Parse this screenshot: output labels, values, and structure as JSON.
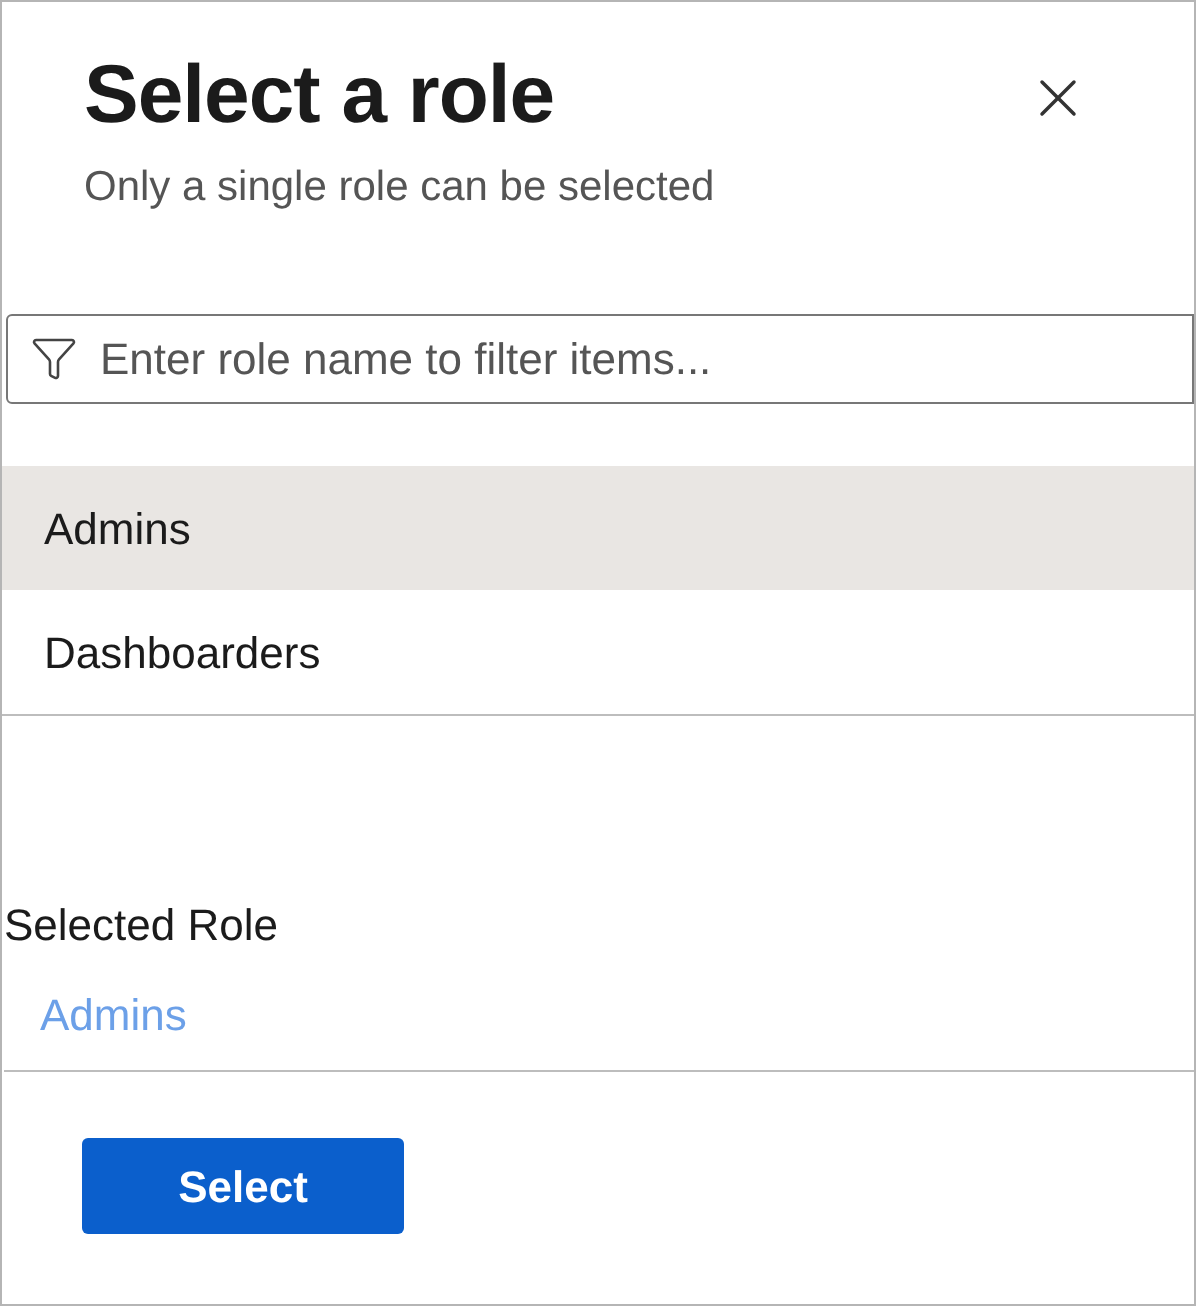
{
  "panel": {
    "title": "Select a role",
    "subtitle": "Only a single role can be selected"
  },
  "filter": {
    "placeholder": "Enter role name to filter items..."
  },
  "roles": [
    {
      "label": "Admins",
      "selected": true
    },
    {
      "label": "Dashboarders",
      "selected": false
    }
  ],
  "selection": {
    "label": "Selected Role",
    "value": "Admins"
  },
  "buttons": [
    "Select"
  ]
}
